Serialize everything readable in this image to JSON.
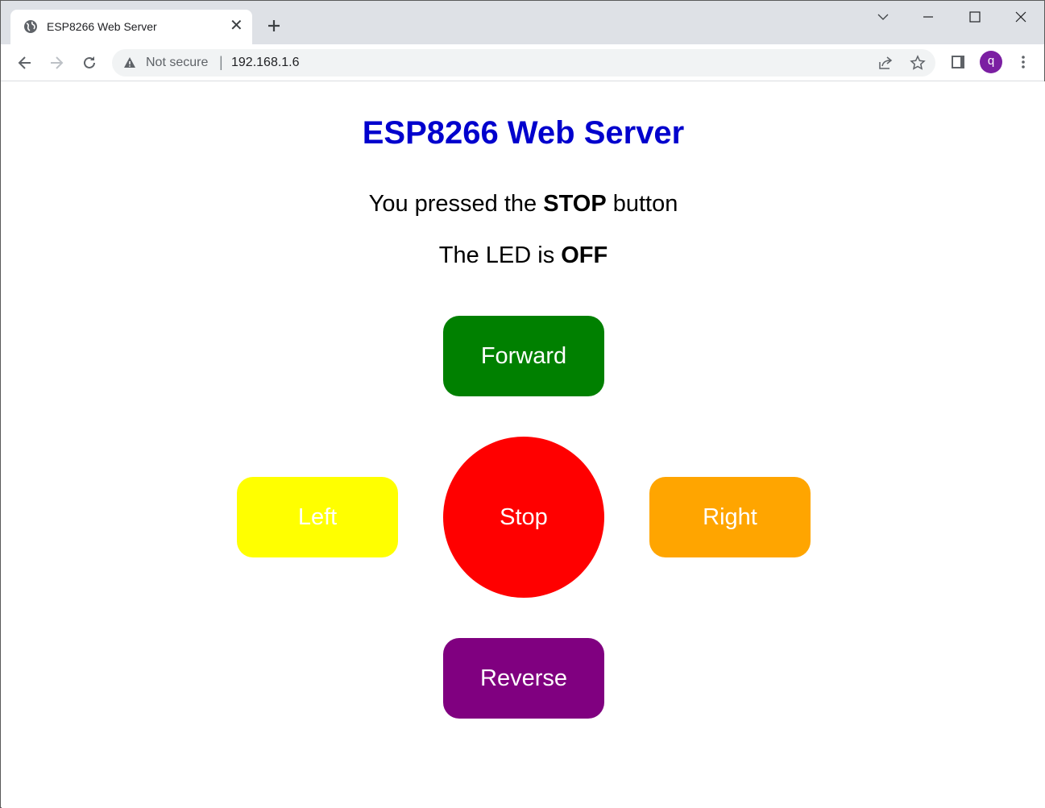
{
  "browser": {
    "tab_title": "ESP8266 Web Server",
    "security_label": "Not secure",
    "url": "192.168.1.6",
    "profile_initial": "q",
    "profile_color": "#7b1fa2"
  },
  "page": {
    "heading": "ESP8266 Web Server",
    "heading_color": "#0000cd",
    "status_line1": {
      "prefix": "You pressed the ",
      "value": "STOP",
      "suffix": " button"
    },
    "status_line2": {
      "prefix": "The LED is ",
      "value": "OFF"
    },
    "buttons": {
      "forward": {
        "label": "Forward",
        "color": "#008000"
      },
      "left": {
        "label": "Left",
        "color": "#ffff00"
      },
      "stop": {
        "label": "Stop",
        "color": "#ff0000"
      },
      "right": {
        "label": "Right",
        "color": "#ffa500"
      },
      "reverse": {
        "label": "Reverse",
        "color": "#800080"
      }
    }
  }
}
